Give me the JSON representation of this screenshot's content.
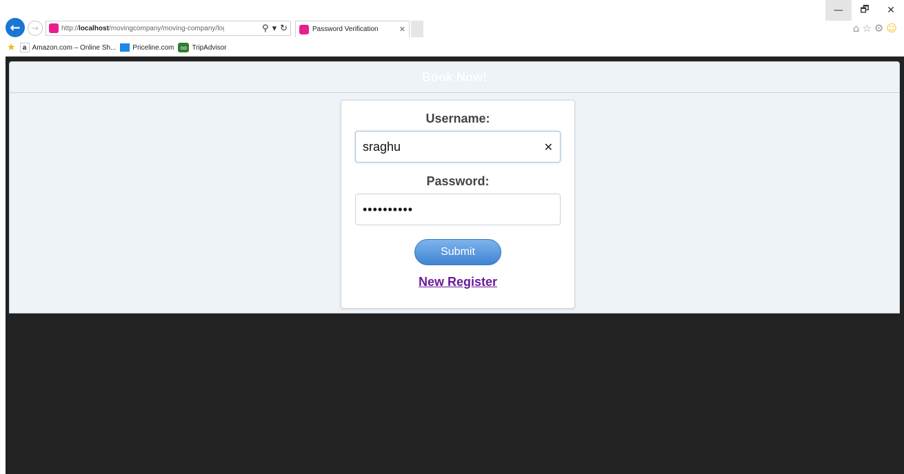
{
  "window": {
    "minimize_glyph": "—",
    "restore_glyph": "🗗",
    "close_glyph": "✕"
  },
  "browser": {
    "back_glyph": "←",
    "forward_glyph": "→",
    "address": {
      "prefix": "http://",
      "host": "localhost",
      "path": "/movingcompany/moving-company/login.html"
    },
    "search_glyph": "⚲",
    "dropdown_glyph": "▾",
    "refresh_glyph": "↻",
    "tab": {
      "title": "Password Verification",
      "close_glyph": "✕"
    },
    "icons": {
      "home": "⌂",
      "favorites": "☆",
      "settings": "⚙",
      "feedback": "☺"
    },
    "favorites_bar": [
      {
        "label": "Amazon.com – Online Sh...",
        "icon": "amazon-icon",
        "glyph": "a"
      },
      {
        "label": "Priceline.com",
        "icon": "priceline-icon"
      },
      {
        "label": "TripAdvisor",
        "icon": "tripadvisor-icon",
        "glyph": "oo"
      }
    ],
    "favorites_star_glyph": "★"
  },
  "page": {
    "header_title": "Book Now!",
    "login": {
      "username_label": "Username:",
      "username_value": "sraghu",
      "clear_glyph": "✕",
      "password_label": "Password:",
      "password_value": "••••••••••",
      "submit_label": "Submit",
      "register_link": "New Register"
    }
  },
  "colors": {
    "viewport_bg": "#222222",
    "panel_bg": "#eef3f7",
    "submit_bg": "#4a8fd8",
    "register_link": "#6a1b9a"
  }
}
